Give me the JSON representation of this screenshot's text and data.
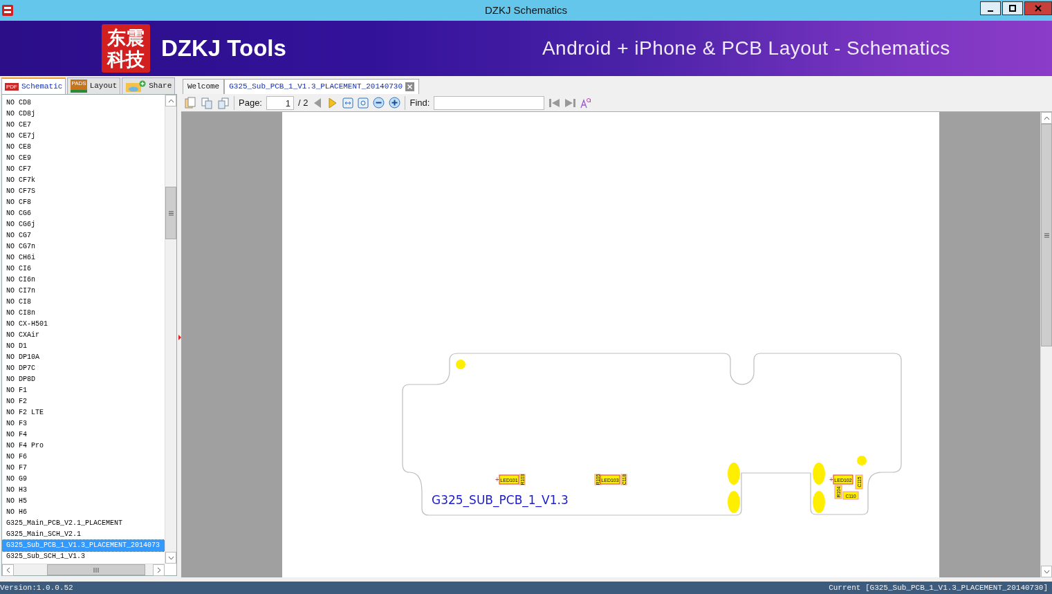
{
  "window": {
    "title": "DZKJ Schematics"
  },
  "banner": {
    "logo_lines": [
      "东震",
      "科技"
    ],
    "brand": "DZKJ Tools",
    "tagline": "Android + iPhone & PCB Layout - Schematics"
  },
  "side_tabs": [
    {
      "label": "Schematic",
      "kind": "pdf",
      "icon_text": "PDF",
      "selected": true
    },
    {
      "label": "Layout",
      "kind": "pads",
      "icon_text": "PADS",
      "selected": false
    },
    {
      "label": "Share",
      "kind": "share",
      "selected": false
    }
  ],
  "file_list": {
    "items": [
      {
        "label": "NO CD8",
        "selected": false
      },
      {
        "label": "NO CD8j",
        "selected": false
      },
      {
        "label": "NO CE7",
        "selected": false
      },
      {
        "label": "NO CE7j",
        "selected": false
      },
      {
        "label": "NO CE8",
        "selected": false
      },
      {
        "label": "NO CE9",
        "selected": false
      },
      {
        "label": "NO CF7",
        "selected": false
      },
      {
        "label": "NO CF7k",
        "selected": false
      },
      {
        "label": "NO CF7S",
        "selected": false
      },
      {
        "label": "NO CF8",
        "selected": false
      },
      {
        "label": "NO CG6",
        "selected": false
      },
      {
        "label": "NO CG6j",
        "selected": false
      },
      {
        "label": "NO CG7",
        "selected": false
      },
      {
        "label": "NO CG7n",
        "selected": false
      },
      {
        "label": "NO CH6i",
        "selected": false
      },
      {
        "label": "NO CI6",
        "selected": false
      },
      {
        "label": "NO CI6n",
        "selected": false
      },
      {
        "label": "NO CI7n",
        "selected": false
      },
      {
        "label": "NO CI8",
        "selected": false
      },
      {
        "label": "NO CI8n",
        "selected": false
      },
      {
        "label": "NO CX-H501",
        "selected": false
      },
      {
        "label": "NO CXAir",
        "selected": false
      },
      {
        "label": "NO D1",
        "selected": false
      },
      {
        "label": "NO DP10A",
        "selected": false
      },
      {
        "label": "NO DP7C",
        "selected": false
      },
      {
        "label": "NO DP8D",
        "selected": false
      },
      {
        "label": "NO F1",
        "selected": false
      },
      {
        "label": "NO F2",
        "selected": false
      },
      {
        "label": "NO F2 LTE",
        "selected": false
      },
      {
        "label": "NO F3",
        "selected": false
      },
      {
        "label": "NO F4",
        "selected": false
      },
      {
        "label": "NO F4 Pro",
        "selected": false
      },
      {
        "label": "NO F6",
        "selected": false
      },
      {
        "label": "NO F7",
        "selected": false
      },
      {
        "label": "NO G9",
        "selected": false
      },
      {
        "label": "NO H3",
        "selected": false
      },
      {
        "label": "NO H5",
        "selected": false
      },
      {
        "label": "NO H6",
        "selected": false
      },
      {
        "label": "G325_Main_PCB_V2.1_PLACEMENT",
        "selected": false
      },
      {
        "label": "G325_Main_SCH_V2.1",
        "selected": false
      },
      {
        "label": "G325_Sub_PCB_1_V1.3_PLACEMENT_2014073",
        "selected": true
      },
      {
        "label": "G325_Sub_SCH_1_V1.3",
        "selected": false
      }
    ]
  },
  "doc_tabs": [
    {
      "label": "Welcome",
      "selected": false,
      "closable": false
    },
    {
      "label": "G325_Sub_PCB_1_V1.3_PLACEMENT_20140730",
      "selected": true,
      "closable": true
    }
  ],
  "toolbar": {
    "page_label": "Page:",
    "page_value": "1",
    "page_total": "/ 2",
    "find_label": "Find:"
  },
  "board": {
    "title": "G325_SUB_PCB_1_V1.3",
    "components": [
      {
        "ref": "LED101",
        "kind": "led",
        "polarity": "+"
      },
      {
        "ref": "R103",
        "kind": "vertical"
      },
      {
        "ref": "R105",
        "kind": "vertical"
      },
      {
        "ref": "LED103",
        "kind": "led"
      },
      {
        "ref": "C118",
        "kind": "vertical"
      },
      {
        "ref": "LED102",
        "kind": "led",
        "polarity": "+"
      },
      {
        "ref": "C115",
        "kind": "vertical"
      },
      {
        "ref": "R104",
        "kind": "vertical"
      },
      {
        "ref": "C110",
        "kind": "small"
      }
    ]
  },
  "status_bar": {
    "version": "Version:1.0.0.52",
    "current": "Current [G325_Sub_PCB_1_V1.3_PLACEMENT_20140730]"
  }
}
